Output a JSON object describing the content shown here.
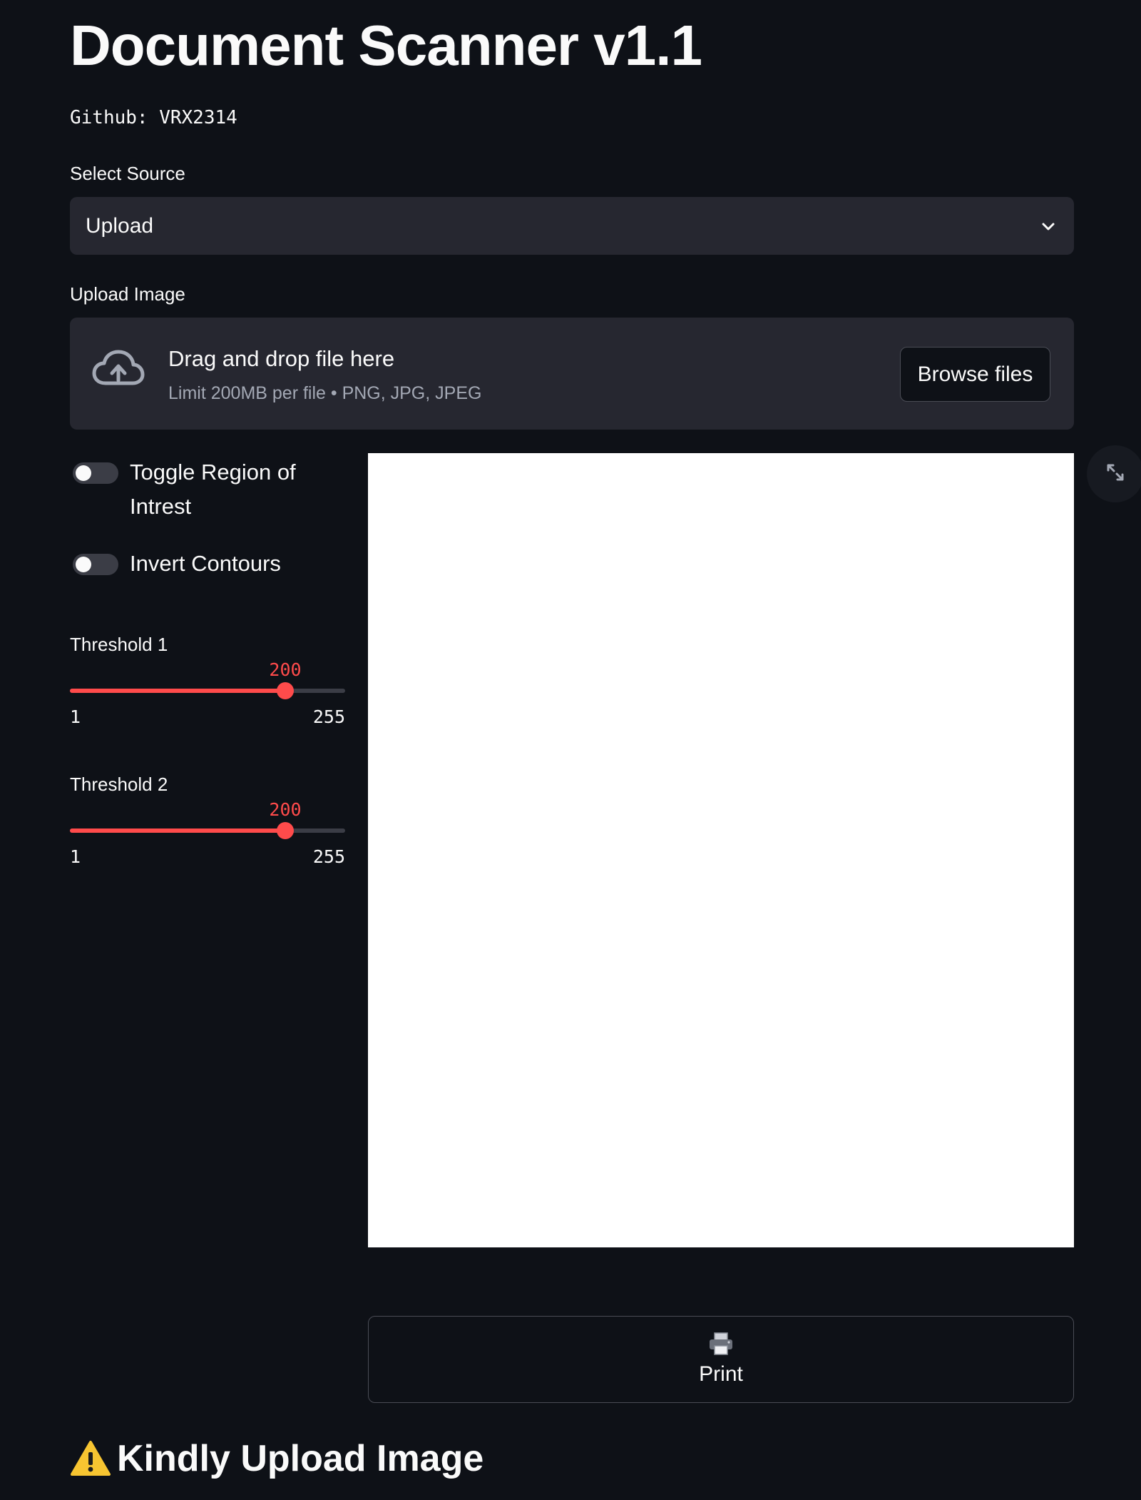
{
  "app": {
    "title": "Document Scanner v1.1",
    "github": "Github: VRX2314"
  },
  "source": {
    "label": "Select Source",
    "selected": "Upload"
  },
  "uploader": {
    "label": "Upload Image",
    "drop_text": "Drag and drop file here",
    "limit_text": "Limit 200MB per file • PNG, JPG, JPEG",
    "browse_label": "Browse files"
  },
  "toggles": [
    {
      "label": "Toggle Region of Intrest",
      "on": false
    },
    {
      "label": "Invert Contours",
      "on": false
    }
  ],
  "sliders": [
    {
      "label": "Threshold 1",
      "value": 200,
      "min": 1,
      "max": 255
    },
    {
      "label": "Threshold 2",
      "value": 200,
      "min": 1,
      "max": 255
    }
  ],
  "print": {
    "label": "Print",
    "icon": "printer-icon"
  },
  "warning": {
    "icon": "warning-icon",
    "text": "Kindly Upload Image"
  },
  "colors": {
    "background": "#0e1117",
    "widget": "#262730",
    "accent": "#ff4b4b",
    "text": "#fafafa",
    "muted": "#a3a8b4"
  }
}
